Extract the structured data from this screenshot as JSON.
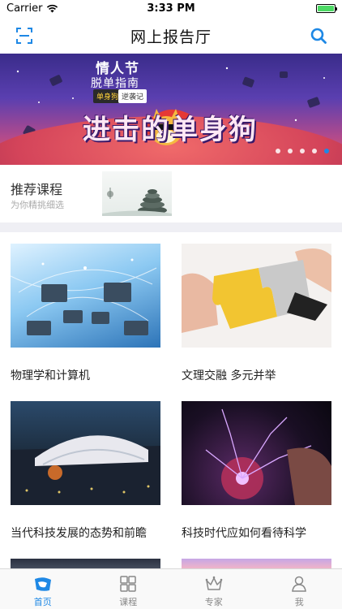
{
  "status": {
    "carrier": "Carrier",
    "time": "3:33 PM",
    "battery_level": 1.0
  },
  "nav": {
    "title": "网上报告厅",
    "left_icon": "scan-icon",
    "right_icon": "search-icon",
    "accent": "#1e88e5"
  },
  "banner": {
    "heading": "情人节",
    "subheading": "脱单指南",
    "tag_a": "单身狗",
    "tag_b": "逆袭记",
    "headline": "进击的单身狗",
    "page_count": 5,
    "active_page": 5
  },
  "recommend": {
    "title": "推荐课程",
    "subtitle": "为你精挑细选"
  },
  "courses": [
    {
      "title": "物理学和计算机"
    },
    {
      "title": "文理交融 多元并举"
    },
    {
      "title": "当代科技发展的态势和前瞻"
    },
    {
      "title": "科技时代应如何看待科学"
    }
  ],
  "tabs": [
    {
      "label": "首页",
      "icon": "home-icon",
      "active": true
    },
    {
      "label": "课程",
      "icon": "grid-icon",
      "active": false
    },
    {
      "label": "专家",
      "icon": "crown-icon",
      "active": false
    },
    {
      "label": "我",
      "icon": "person-icon",
      "active": false
    }
  ]
}
